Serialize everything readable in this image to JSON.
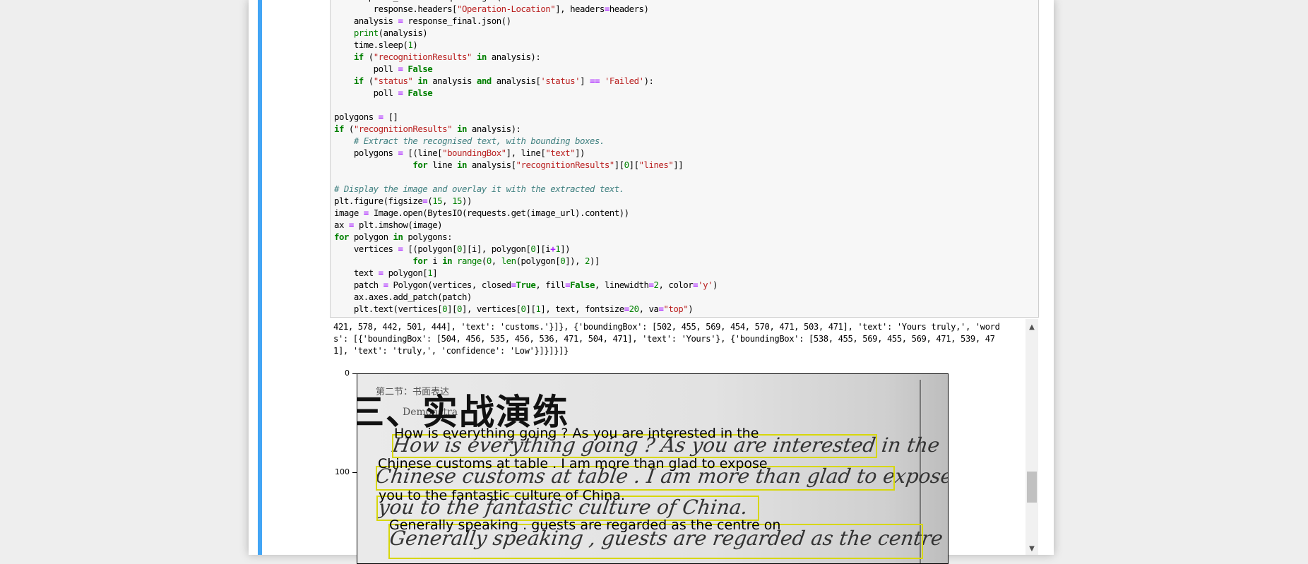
{
  "code_lines": [
    "    response_final = requests.get(",
    "        response.headers[\"Operation-Location\"], headers=headers)",
    "    analysis = response_final.json()",
    "    print(analysis)",
    "    time.sleep(1)",
    "    if (\"recognitionResults\" in analysis):",
    "        poll = False",
    "    if (\"status\" in analysis and analysis['status'] == 'Failed'):",
    "        poll = False",
    "",
    "polygons = []",
    "if (\"recognitionResults\" in analysis):",
    "    # Extract the recognised text, with bounding boxes.",
    "    polygons = [(line[\"boundingBox\"], line[\"text\"])",
    "                for line in analysis[\"recognitionResults\"][0][\"lines\"]]",
    "",
    "# Display the image and overlay it with the extracted text.",
    "plt.figure(figsize=(15, 15))",
    "image = Image.open(BytesIO(requests.get(image_url).content))",
    "ax = plt.imshow(image)",
    "for polygon in polygons:",
    "    vertices = [(polygon[0][i], polygon[0][i+1])",
    "                for i in range(0, len(polygon[0]), 2)]",
    "    text = polygon[1]",
    "    patch = Polygon(vertices, closed=True, fill=False, linewidth=2, color='y')",
    "    ax.axes.add_patch(patch)",
    "    plt.text(vertices[0][0], vertices[0][1], text, fontsize=20, va=\"top\")"
  ],
  "output_lines": [
    "421, 578, 442, 501, 444], 'text': 'customs.'}]}, {'boundingBox': [502, 455, 569, 454, 570, 471, 503, 471], 'text': 'Yours truly,', 'word",
    "s': [{'boundingBox': [504, 456, 535, 456, 536, 471, 504, 471], 'text': 'Yours'}, {'boundingBox': [538, 455, 569, 455, 569, 471, 539, 47",
    "1], 'text': 'truly,', 'confidence': 'Low'}]}]}]}"
  ],
  "figure": {
    "yticks": [
      "0",
      "100"
    ],
    "photo_small_text": [
      "第二节：书面表达",
      "Demonstra"
    ],
    "photo_heading": "三、实战演练",
    "handwritten_lines": [
      "How is everything going ? As you are interested in the",
      "Chinese customs at table . I am more than glad to expose",
      "you to the fantastic culture of China.",
      "Generally speaking , guests are regarded as the centre on"
    ],
    "ocr_texts": [
      "How is everything going ? As you are interested in the",
      "Chinese customs at table . I am more than glad to expose",
      "you to the fantastic culture of China.",
      "Generally speaking . guests are regarded as the centre on"
    ],
    "bbox_color": "#d7d70a"
  },
  "scrollbar": {
    "up_icon": "▲",
    "down_icon": "▼"
  },
  "colors": {
    "cell_accent": "#42a5f5"
  }
}
